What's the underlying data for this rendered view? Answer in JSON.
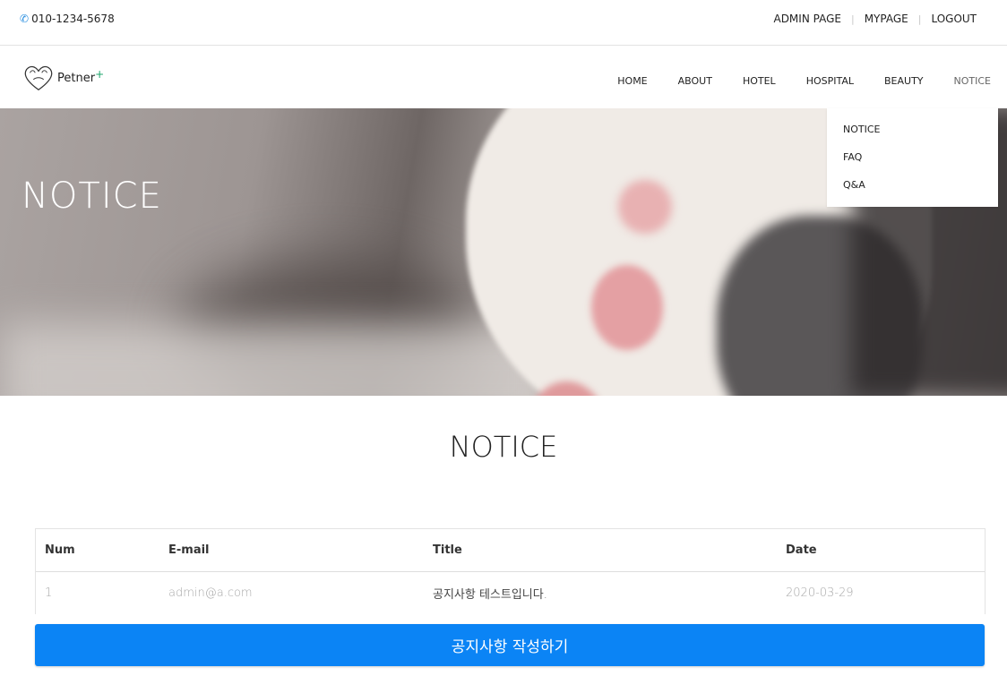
{
  "top_bar": {
    "phone": "010-1234-5678",
    "links": [
      "ADMIN PAGE",
      "MYPAGE",
      "LOGOUT"
    ]
  },
  "brand": {
    "name": "Petner",
    "suffix": "+"
  },
  "nav": {
    "items": [
      "HOME",
      "ABOUT",
      "HOTEL",
      "HOSPITAL",
      "BEAUTY",
      "NOTICE"
    ],
    "active": "NOTICE"
  },
  "dropdown": {
    "items": [
      "NOTICE",
      "FAQ",
      "Q&A"
    ]
  },
  "hero": {
    "title": "NOTICE"
  },
  "section": {
    "title": "NOTICE"
  },
  "table": {
    "headers": [
      "Num",
      "E-mail",
      "Title",
      "Date"
    ],
    "rows": [
      {
        "num": "1",
        "email": "admin@a.com",
        "title": "공지사항 테스트입니다.",
        "date": "2020-03-29"
      }
    ]
  },
  "write_button": {
    "label": "공지사항 작성하기"
  },
  "colors": {
    "accent_blue": "#0b84f5",
    "brand_green": "#1ca56b",
    "phone_icon": "#2b8fe0"
  }
}
